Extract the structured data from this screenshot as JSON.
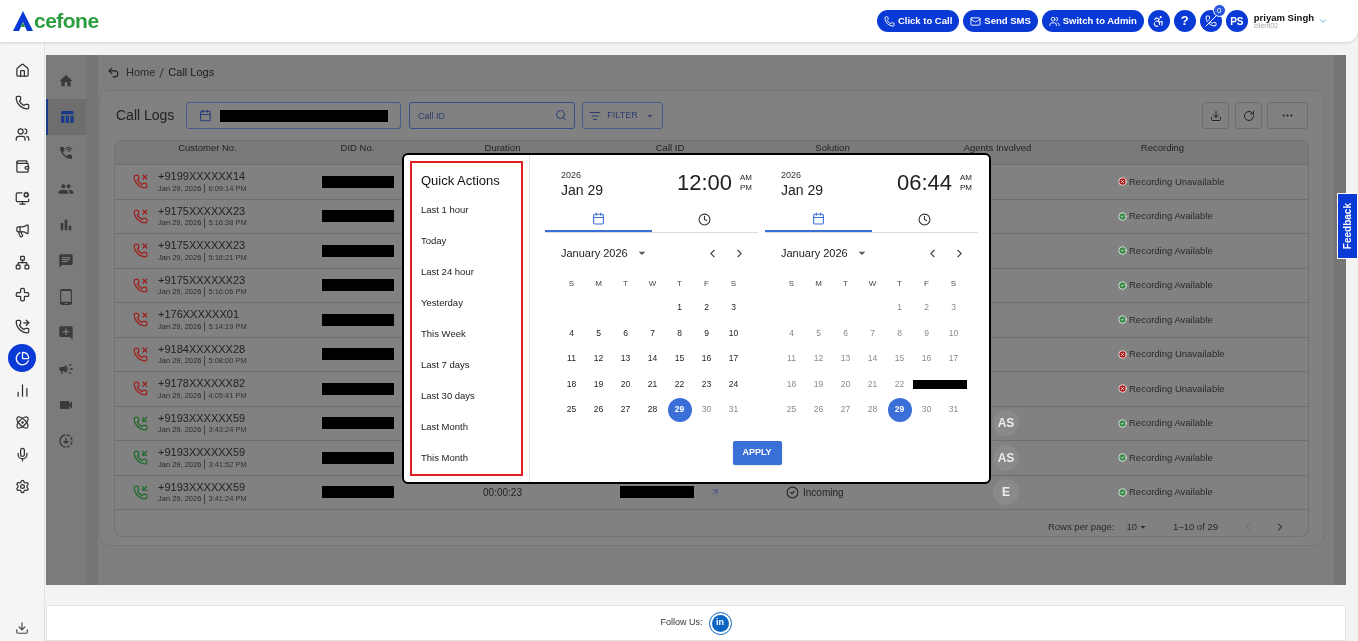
{
  "header": {
    "logo": "cefone",
    "actions": [
      {
        "kind": "call",
        "label": "Click to Call"
      },
      {
        "kind": "sms",
        "label": "Send SMS"
      },
      {
        "kind": "admin",
        "label": "Switch to Admin"
      }
    ],
    "help": "?",
    "call_badge": "0",
    "user": {
      "initials": "PS",
      "name": "priyam Singh",
      "account": "client02"
    }
  },
  "nav": [
    {
      "selected": false
    },
    {
      "selected": false
    },
    {
      "selected": false
    },
    {
      "selected": false
    },
    {
      "selected": false
    },
    {
      "selected": false
    },
    {
      "selected": false
    },
    {
      "selected": false
    },
    {
      "selected": false
    },
    {
      "selected": true
    },
    {
      "selected": false
    },
    {
      "selected": false
    },
    {
      "selected": false
    },
    {
      "selected": false
    }
  ],
  "subnav": [
    {
      "selected": false
    },
    {
      "selected": true
    },
    {
      "selected": false
    },
    {
      "selected": false
    },
    {
      "selected": false
    },
    {
      "selected": false
    },
    {
      "selected": false
    },
    {
      "selected": false
    },
    {
      "selected": false
    },
    {
      "selected": false
    },
    {
      "selected": false
    }
  ],
  "breadcrumb": [
    "Home",
    "Call Logs"
  ],
  "page_title": "Call Logs",
  "toolbar": {
    "date_range_redacted": true,
    "search_placeholder": "Call ID",
    "filter": "FILTER"
  },
  "table": {
    "columns": [
      "Customer No.",
      "DID No.",
      "Duration",
      "Call ID",
      "Solution",
      "Agents Involved",
      "Recording"
    ],
    "rows": [
      {
        "kind": "missed",
        "customer": "+9199XXXXXX14",
        "date": "Jan 29, 2026",
        "time": "6:09:14 PM",
        "did_redacted": true,
        "recording": {
          "text": "Recording Unavailable",
          "available": false
        }
      },
      {
        "kind": "missed",
        "customer": "+9175XXXXXX23",
        "date": "Jan 29, 2026",
        "time": "5:16:38 PM",
        "did_redacted": true,
        "recording": {
          "text": "Recording Available",
          "available": true
        }
      },
      {
        "kind": "missed",
        "customer": "+9175XXXXXX23",
        "date": "Jan 29, 2026",
        "time": "5:16:21 PM",
        "did_redacted": true,
        "recording": {
          "text": "Recording Available",
          "available": true
        }
      },
      {
        "kind": "missed",
        "customer": "+9175XXXXXX23",
        "date": "Jan 29, 2026",
        "time": "5:16:06 PM",
        "did_redacted": true,
        "recording": {
          "text": "Recording Available",
          "available": true
        }
      },
      {
        "kind": "missed",
        "customer": "+176XXXXXX01",
        "date": "Jan 29, 2026",
        "time": "5:14:19 PM",
        "did_redacted": true,
        "recording": {
          "text": "Recording Available",
          "available": true
        }
      },
      {
        "kind": "missed",
        "customer": "+9184XXXXXX28",
        "date": "Jan 29, 2026",
        "time": "5:08:00 PM",
        "did_redacted": true,
        "recording": {
          "text": "Recording Unavailable",
          "available": false
        }
      },
      {
        "kind": "missed",
        "customer": "+9178XXXXXX82",
        "date": "Jan 29, 2026",
        "time": "4:05:41 PM",
        "did_redacted": true,
        "recording": {
          "text": "Recording Unavailable",
          "available": false
        }
      },
      {
        "kind": "incoming",
        "customer": "+9193XXXXXX59",
        "date": "Jan 29, 2026",
        "time": "3:43:24 PM",
        "did_redacted": true,
        "agents": [
          "AS"
        ],
        "recording": {
          "text": "Recording Available",
          "available": true
        }
      },
      {
        "kind": "incoming",
        "customer": "+9193XXXXXX59",
        "date": "Jan 29, 2026",
        "time": "3:41:52 PM",
        "did_redacted": true,
        "agents": [
          "AS"
        ],
        "recording": {
          "text": "Recording Available",
          "available": true
        }
      },
      {
        "kind": "incoming",
        "customer": "+9193XXXXXX59",
        "date": "Jan 29, 2026",
        "time": "3:41:24 PM",
        "did_redacted": true,
        "duration": "00:00:23",
        "call_id_redacted": true,
        "solution": "Incoming",
        "agents": [
          "E"
        ],
        "recording": {
          "text": "Recording Available",
          "available": true
        }
      }
    ],
    "rows_per_page_label": "Rows per page:",
    "rows_per_page": "10",
    "range": "1–10 of 29"
  },
  "picker": {
    "quick_title": "Quick Actions",
    "quick_actions": [
      "Last 1 hour",
      "Today",
      "Last 24 hour",
      "Yesterday",
      "This Week",
      "Last 7 days",
      "Last 30 days",
      "Last Month",
      "This Month"
    ],
    "panels": [
      {
        "year": "2026",
        "date": "Jan 29",
        "time": "12:00",
        "am": "AM",
        "pm": "PM",
        "month": "January 2026",
        "weekdays": [
          "S",
          "M",
          "T",
          "W",
          "T",
          "F",
          "S"
        ],
        "days": [
          {
            "kind": "blank"
          },
          {
            "kind": "blank"
          },
          {
            "kind": "blank"
          },
          {
            "kind": "blank"
          },
          {
            "kind": "day",
            "text": "1",
            "selected": false,
            "disabled": false
          },
          {
            "kind": "day",
            "text": "2",
            "selected": false,
            "disabled": false
          },
          {
            "kind": "day",
            "text": "3",
            "selected": false,
            "disabled": false
          },
          {
            "kind": "day",
            "text": "4",
            "selected": false,
            "disabled": false
          },
          {
            "kind": "day",
            "text": "5",
            "selected": false,
            "disabled": false
          },
          {
            "kind": "day",
            "text": "6",
            "selected": false,
            "disabled": false
          },
          {
            "kind": "day",
            "text": "7",
            "selected": false,
            "disabled": false
          },
          {
            "kind": "day",
            "text": "8",
            "selected": false,
            "disabled": false
          },
          {
            "kind": "day",
            "text": "9",
            "selected": false,
            "disabled": false
          },
          {
            "kind": "day",
            "text": "10",
            "selected": false,
            "disabled": false
          },
          {
            "kind": "day",
            "text": "11",
            "selected": false,
            "disabled": false
          },
          {
            "kind": "day",
            "text": "12",
            "selected": false,
            "disabled": false
          },
          {
            "kind": "day",
            "text": "13",
            "selected": false,
            "disabled": false
          },
          {
            "kind": "day",
            "text": "14",
            "selected": false,
            "disabled": false
          },
          {
            "kind": "day",
            "text": "15",
            "selected": false,
            "disabled": false
          },
          {
            "kind": "day",
            "text": "16",
            "selected": false,
            "disabled": false
          },
          {
            "kind": "day",
            "text": "17",
            "selected": false,
            "disabled": false
          },
          {
            "kind": "day",
            "text": "18",
            "selected": false,
            "disabled": false
          },
          {
            "kind": "day",
            "text": "19",
            "selected": false,
            "disabled": false
          },
          {
            "kind": "day",
            "text": "20",
            "selected": false,
            "disabled": false
          },
          {
            "kind": "day",
            "text": "21",
            "selected": false,
            "disabled": false
          },
          {
            "kind": "day",
            "text": "22",
            "selected": false,
            "disabled": false
          },
          {
            "kind": "day",
            "text": "23",
            "selected": false,
            "disabled": false
          },
          {
            "kind": "day",
            "text": "24",
            "selected": false,
            "disabled": false
          },
          {
            "kind": "day",
            "text": "25",
            "selected": false,
            "disabled": false
          },
          {
            "kind": "day",
            "text": "26",
            "selected": false,
            "disabled": false
          },
          {
            "kind": "day",
            "text": "27",
            "selected": false,
            "disabled": false
          },
          {
            "kind": "day",
            "text": "28",
            "selected": false,
            "disabled": false
          },
          {
            "kind": "day",
            "text": "29",
            "selected": true,
            "disabled": false
          },
          {
            "kind": "day",
            "text": "30",
            "selected": false,
            "disabled": true
          },
          {
            "kind": "day",
            "text": "31",
            "selected": false,
            "disabled": true
          }
        ]
      },
      {
        "year": "2026",
        "date": "Jan 29",
        "time": "06:44",
        "am": "AM",
        "pm": "PM",
        "month": "January 2026",
        "weekdays": [
          "S",
          "M",
          "T",
          "W",
          "T",
          "F",
          "S"
        ],
        "days": [
          {
            "kind": "blank"
          },
          {
            "kind": "blank"
          },
          {
            "kind": "blank"
          },
          {
            "kind": "blank"
          },
          {
            "kind": "day",
            "text": "1",
            "selected": false,
            "disabled": true
          },
          {
            "kind": "day",
            "text": "2",
            "selected": false,
            "disabled": true
          },
          {
            "kind": "day",
            "text": "3",
            "selected": false,
            "disabled": true
          },
          {
            "kind": "day",
            "text": "4",
            "selected": false,
            "disabled": true
          },
          {
            "kind": "day",
            "text": "5",
            "selected": false,
            "disabled": true
          },
          {
            "kind": "day",
            "text": "6",
            "selected": false,
            "disabled": true
          },
          {
            "kind": "day",
            "text": "7",
            "selected": false,
            "disabled": true
          },
          {
            "kind": "day",
            "text": "8",
            "selected": false,
            "disabled": true
          },
          {
            "kind": "day",
            "text": "9",
            "selected": false,
            "disabled": true
          },
          {
            "kind": "day",
            "text": "10",
            "selected": false,
            "disabled": true
          },
          {
            "kind": "day",
            "text": "11",
            "selected": false,
            "disabled": true
          },
          {
            "kind": "day",
            "text": "12",
            "selected": false,
            "disabled": true
          },
          {
            "kind": "day",
            "text": "13",
            "selected": false,
            "disabled": true
          },
          {
            "kind": "day",
            "text": "14",
            "selected": false,
            "disabled": true
          },
          {
            "kind": "day",
            "text": "15",
            "selected": false,
            "disabled": true
          },
          {
            "kind": "day",
            "text": "16",
            "selected": false,
            "disabled": true
          },
          {
            "kind": "day",
            "text": "17",
            "selected": false,
            "disabled": true
          },
          {
            "kind": "day",
            "text": "18",
            "selected": false,
            "disabled": true
          },
          {
            "kind": "day",
            "text": "19",
            "selected": false,
            "disabled": true
          },
          {
            "kind": "day",
            "text": "20",
            "selected": false,
            "disabled": true
          },
          {
            "kind": "day",
            "text": "21",
            "selected": false,
            "disabled": true
          },
          {
            "kind": "day",
            "text": "22",
            "selected": false,
            "disabled": true
          },
          {
            "kind": "redacted"
          },
          {
            "kind": "redacted"
          },
          {
            "kind": "day",
            "text": "25",
            "selected": false,
            "disabled": true
          },
          {
            "kind": "day",
            "text": "26",
            "selected": false,
            "disabled": true
          },
          {
            "kind": "day",
            "text": "27",
            "selected": false,
            "disabled": true
          },
          {
            "kind": "day",
            "text": "28",
            "selected": false,
            "disabled": true
          },
          {
            "kind": "day",
            "text": "29",
            "selected": true,
            "disabled": false
          },
          {
            "kind": "day",
            "text": "30",
            "selected": false,
            "disabled": true
          },
          {
            "kind": "day",
            "text": "31",
            "selected": false,
            "disabled": true
          }
        ]
      }
    ],
    "apply": "APPLY"
  },
  "feedback": "Feedback",
  "footer": {
    "follow": "Follow Us:",
    "social": "in"
  }
}
